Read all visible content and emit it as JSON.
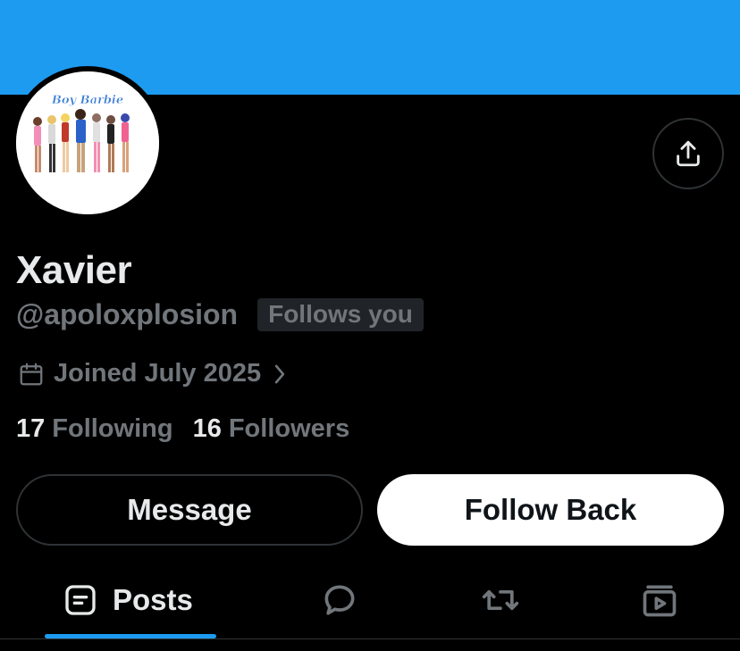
{
  "profile": {
    "name": "Xavier",
    "handle": "@apoloxplosion",
    "follows_you_badge": "Follows you",
    "joined": "Joined July 2025",
    "avatar_text": "Boy Barbie"
  },
  "stats": {
    "following_count": "17",
    "following_label": "Following",
    "followers_count": "16",
    "followers_label": "Followers"
  },
  "actions": {
    "message_label": "Message",
    "follow_back_label": "Follow Back"
  },
  "tabs": [
    {
      "label": "Posts",
      "icon": "posts-icon",
      "active": true
    },
    {
      "label": "",
      "icon": "replies-icon"
    },
    {
      "label": "",
      "icon": "reposts-icon"
    },
    {
      "label": "",
      "icon": "media-icon"
    }
  ],
  "colors": {
    "banner": "#1d9bf0",
    "background": "#000000",
    "text_primary": "#e7e9ea",
    "text_secondary": "#71767b",
    "accent": "#1d9bf0"
  }
}
